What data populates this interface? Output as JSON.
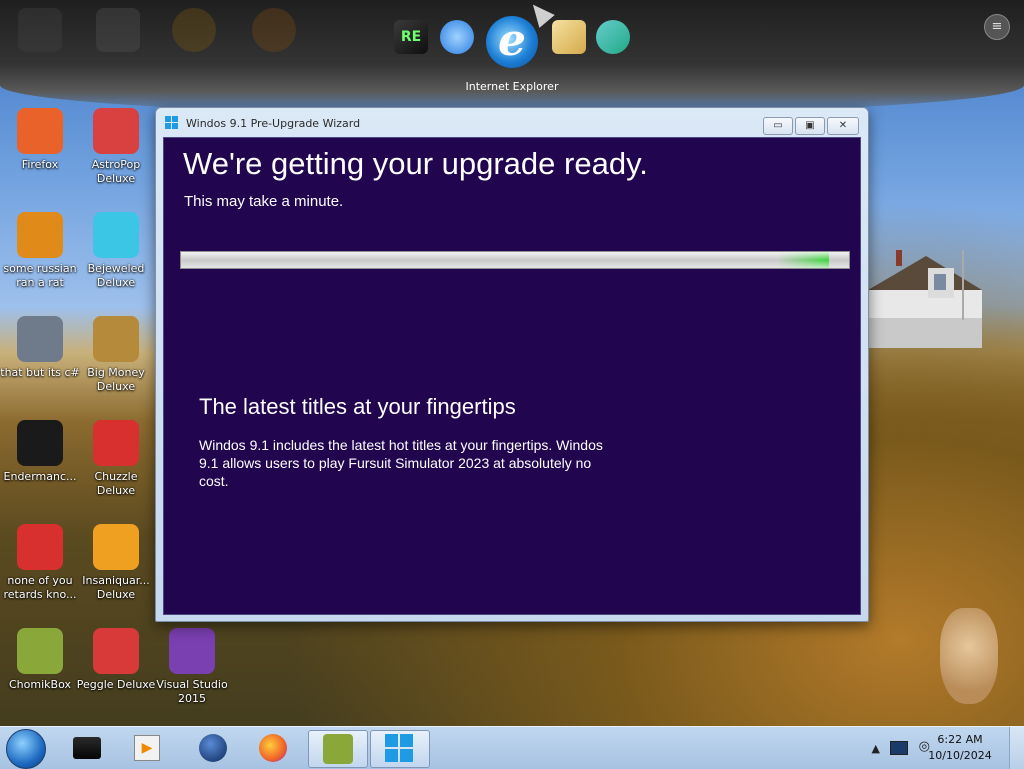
{
  "dock": {
    "active_label": "Internet Explorer",
    "icons": [
      "tiles-icon",
      "network-globe-icon",
      "internet-explorer-icon",
      "folder-mail-icon",
      "users-icon"
    ]
  },
  "desktop_icons": [
    {
      "label": "Firefox",
      "icon": "firefox-icon",
      "color": "#e8622a"
    },
    {
      "label": "AstroPop\nDeluxe",
      "icon": "astropop-icon",
      "color": "#d94040"
    },
    {
      "label": "some russian\nran a rat",
      "icon": "de-icon",
      "color": "#e08a1a"
    },
    {
      "label": "Bejeweled\nDeluxe",
      "icon": "bejeweled-gem-icon",
      "color": "#3cc6e6"
    },
    {
      "label": "that but its c#",
      "icon": "stacked-windows-icon",
      "color": "#6f7b8a"
    },
    {
      "label": "Big Money\nDeluxe",
      "icon": "money-bag-icon",
      "color": "#b58a3a"
    },
    {
      "label": "Endermanc...",
      "icon": "console-icon",
      "color": "#1a1a1a"
    },
    {
      "label": "Chuzzle\nDeluxe",
      "icon": "chuzzle-icon",
      "color": "#d8302e"
    },
    {
      "label": "none of you\nretards kno...",
      "icon": "red-bird-icon",
      "color": "#d8302e"
    },
    {
      "label": "Insaniquar...\nDeluxe",
      "icon": "fish-icon",
      "color": "#f0a020"
    },
    {
      "label": "ChomikBox",
      "icon": "chomikbox-icon",
      "color": "#8aa83a"
    },
    {
      "label": "Peggle Deluxe",
      "icon": "peggle-icon",
      "color": "#d83a3a"
    },
    {
      "label": "Visual Studio\n2015",
      "icon": "visual-studio-icon",
      "color": "#7a3fb0"
    }
  ],
  "window": {
    "title": "Windos 9.1 Pre-Upgrade Wizard",
    "heading": "We're getting your upgrade ready.",
    "subheading": "This may take a minute.",
    "progress_fraction": 0.97,
    "section_title": "The latest titles at your fingertips",
    "section_text": "Windos 9.1 includes the latest hot titles at your fingertips. Windos 9.1 allows users to play Fursuit Simulator 2023 at absolutely no cost.",
    "client_bg": "#21064f"
  },
  "taskbar": {
    "items": [
      "dark-box-icon",
      "media-player-icon",
      "globe-icon",
      "firefox-icon",
      "chomikbox-icon",
      "windows-logo-icon"
    ],
    "active_item": "windows-logo-icon",
    "time": "6:22 AM",
    "date": "10/10/2024"
  }
}
